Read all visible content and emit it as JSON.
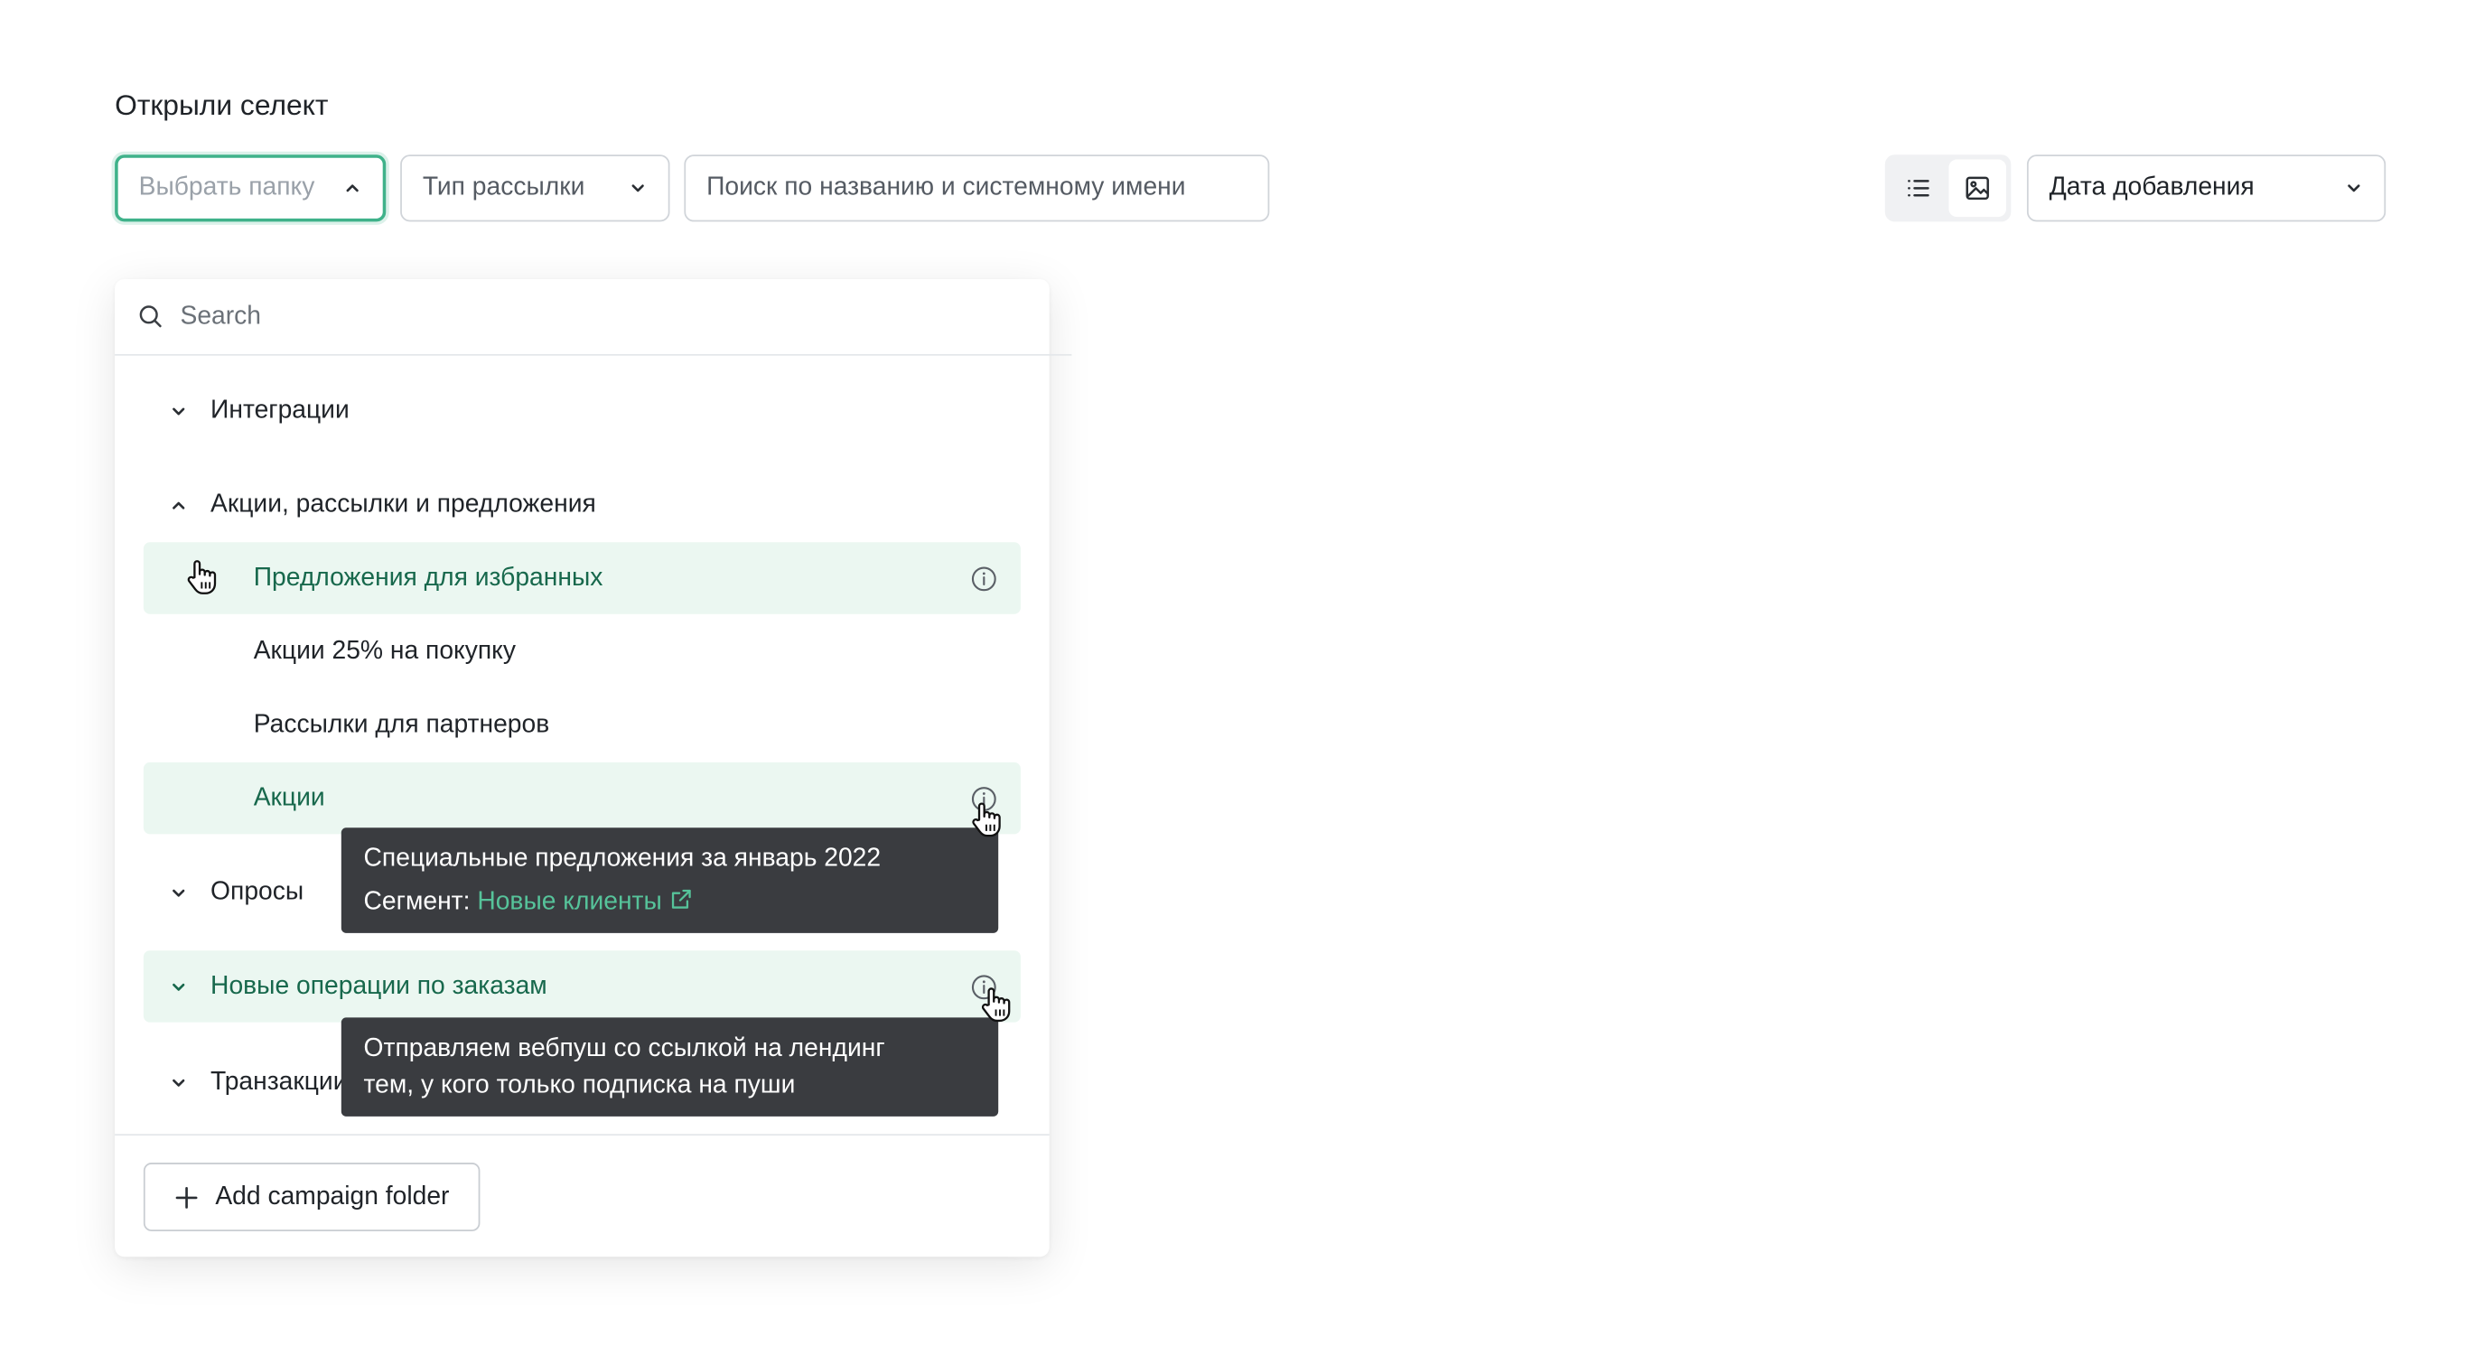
{
  "page": {
    "title": "Открыли селект"
  },
  "filters": {
    "folder_placeholder": "Выбрать папку",
    "type_label": "Тип рассылки",
    "search_placeholder": "Поиск по названию и системному имени",
    "sort_label": "Дата добавления"
  },
  "view_toggle": {
    "list_icon": "list-icon",
    "image_icon": "image-icon",
    "active": "image"
  },
  "dropdown": {
    "search_placeholder": "Search",
    "items": [
      {
        "label": "Интеграции",
        "level": 0,
        "expanded": false
      },
      {
        "label": "Акции, рассылки и предложения",
        "level": 0,
        "expanded": true
      },
      {
        "label": "Предложения для избранных",
        "level": 1,
        "highlighted": true
      },
      {
        "label": "Акции 25% на покупку",
        "level": 1
      },
      {
        "label": "Рассылки для партнеров",
        "level": 1
      },
      {
        "label": "Акции",
        "level": 1,
        "highlighted": true
      },
      {
        "label": "Опросы",
        "level": 0,
        "expanded": false
      },
      {
        "label": "Новые операции по заказам",
        "level": 0,
        "expanded": false,
        "highlighted": true
      },
      {
        "label": "Транзакции",
        "level": 0,
        "expanded": false
      }
    ],
    "add_button": "Add campaign folder"
  },
  "tooltips": {
    "promo": {
      "line1": "Специальные предложения за январь 2022",
      "segment_prefix": "Сегмент: ",
      "segment_link": "Новые клиенты"
    },
    "orders": {
      "line1": "Отправляем вебпуш со ссылкой на лендинг",
      "line2": "тем, у кого только подписка на пуши"
    }
  },
  "colors": {
    "accent": "#3fb28a",
    "highlight_bg": "#ebf7f1",
    "highlight_text": "#17684c",
    "tooltip_bg": "#3a3c40"
  }
}
